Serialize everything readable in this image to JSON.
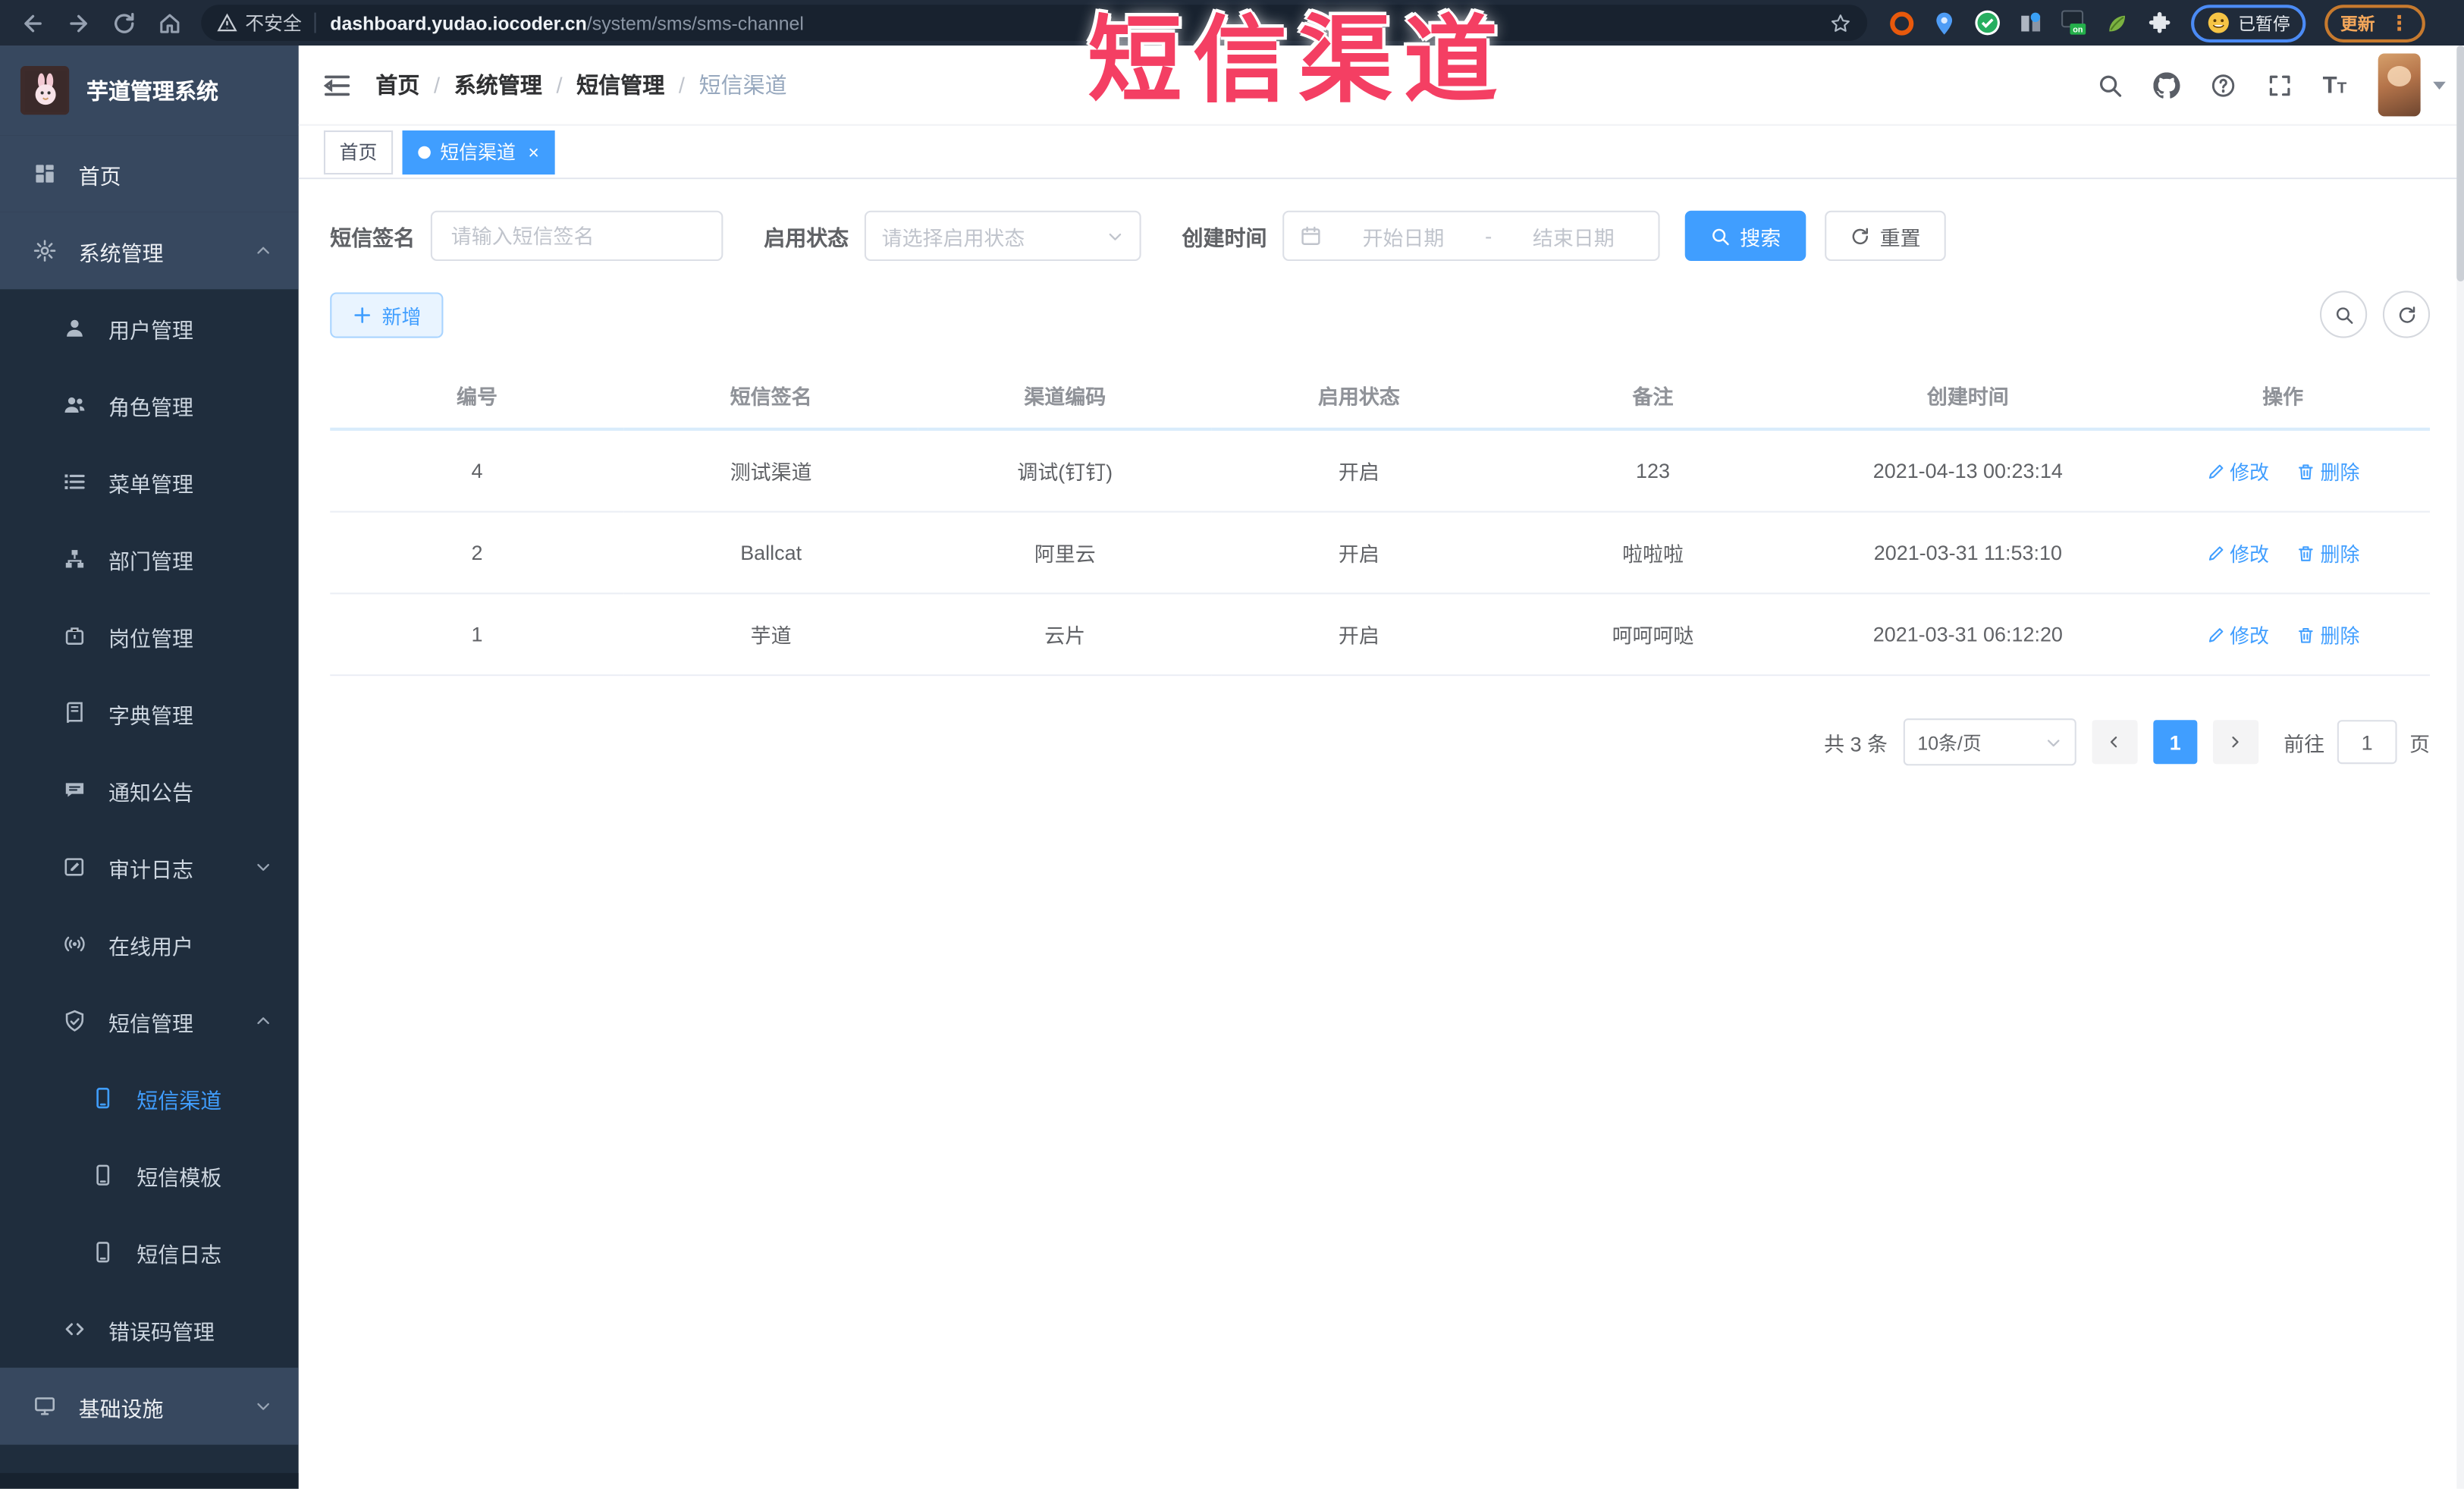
{
  "browser": {
    "security_label": "不安全",
    "url_domain": "dashboard.yudao.iocoder.cn",
    "url_path": "/system/sms/sms-channel",
    "paused_badge": "已暂停",
    "update_button": "更新",
    "menu_dots": "⋮"
  },
  "overlay": {
    "title": "短信渠道",
    "color": "#f43f63"
  },
  "sidebar": {
    "app_title": "芋道管理系统",
    "items": [
      {
        "label": "首页"
      },
      {
        "label": "系统管理",
        "expanded": true
      },
      {
        "label": "用户管理"
      },
      {
        "label": "角色管理"
      },
      {
        "label": "菜单管理"
      },
      {
        "label": "部门管理"
      },
      {
        "label": "岗位管理"
      },
      {
        "label": "字典管理"
      },
      {
        "label": "通知公告"
      },
      {
        "label": "审计日志",
        "expanded": false
      },
      {
        "label": "在线用户"
      },
      {
        "label": "短信管理",
        "expanded": true
      },
      {
        "label": "短信渠道",
        "active": true
      },
      {
        "label": "短信模板"
      },
      {
        "label": "短信日志"
      },
      {
        "label": "错误码管理"
      },
      {
        "label": "基础设施",
        "expanded": false
      }
    ]
  },
  "breadcrumb": {
    "items": [
      "首页",
      "系统管理",
      "短信管理",
      "短信渠道"
    ],
    "separator": "/"
  },
  "tags": [
    {
      "label": "首页",
      "active": false
    },
    {
      "label": "短信渠道",
      "active": true,
      "close": "×"
    }
  ],
  "filters": {
    "signature_label": "短信签名",
    "signature_placeholder": "请输入短信签名",
    "status_label": "启用状态",
    "status_placeholder": "请选择启用状态",
    "time_label": "创建时间",
    "date_start_placeholder": "开始日期",
    "date_separator": "-",
    "date_end_placeholder": "结束日期",
    "search_button": "搜索",
    "reset_button": "重置"
  },
  "toolbar": {
    "add_button": "新增"
  },
  "table": {
    "headers": [
      "编号",
      "短信签名",
      "渠道编码",
      "启用状态",
      "备注",
      "创建时间",
      "操作"
    ],
    "edit_label": "修改",
    "delete_label": "删除",
    "rows": [
      {
        "id": "4",
        "signature": "测试渠道",
        "code": "调试(钉钉)",
        "status": "开启",
        "remark": "123",
        "created": "2021-04-13 00:23:14"
      },
      {
        "id": "2",
        "signature": "Ballcat",
        "code": "阿里云",
        "status": "开启",
        "remark": "啦啦啦",
        "created": "2021-03-31 11:53:10"
      },
      {
        "id": "1",
        "signature": "芋道",
        "code": "云片",
        "status": "开启",
        "remark": "呵呵呵哒",
        "created": "2021-03-31 06:12:20"
      }
    ]
  },
  "pagination": {
    "total_label": "共 3 条",
    "page_size": "10条/页",
    "current_page": "1",
    "goto_label": "前往",
    "goto_value": "1",
    "page_label": "页"
  },
  "colors": {
    "accent": "#409EFF",
    "sidebar_bg": "#1f2d3d",
    "sidebar_top_bg": "#37485f",
    "overlay_red": "#f43f63"
  }
}
